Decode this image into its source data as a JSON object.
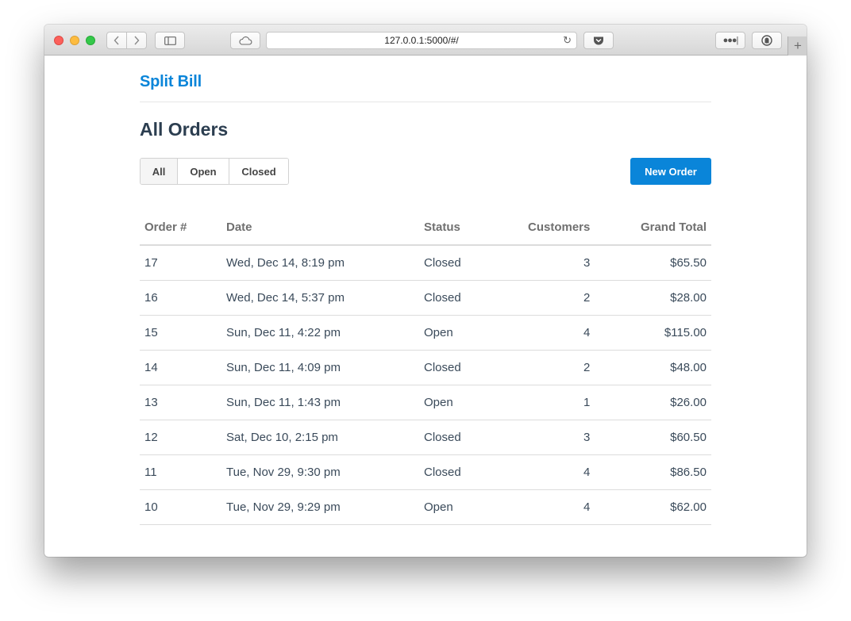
{
  "browser": {
    "url": "127.0.0.1:5000/#/"
  },
  "app": {
    "brand": "Split Bill"
  },
  "page": {
    "title": "All Orders",
    "filters": [
      "All",
      "Open",
      "Closed"
    ],
    "active_filter": "All",
    "new_order_label": "New Order"
  },
  "table": {
    "headers": [
      "Order #",
      "Date",
      "Status",
      "Customers",
      "Grand Total"
    ],
    "rows": [
      {
        "order": "17",
        "date": "Wed, Dec 14, 8:19 pm",
        "status": "Closed",
        "customers": "3",
        "total": "$65.50"
      },
      {
        "order": "16",
        "date": "Wed, Dec 14, 5:37 pm",
        "status": "Closed",
        "customers": "2",
        "total": "$28.00"
      },
      {
        "order": "15",
        "date": "Sun, Dec 11, 4:22 pm",
        "status": "Open",
        "customers": "4",
        "total": "$115.00"
      },
      {
        "order": "14",
        "date": "Sun, Dec 11, 4:09 pm",
        "status": "Closed",
        "customers": "2",
        "total": "$48.00"
      },
      {
        "order": "13",
        "date": "Sun, Dec 11, 1:43 pm",
        "status": "Open",
        "customers": "1",
        "total": "$26.00"
      },
      {
        "order": "12",
        "date": "Sat, Dec 10, 2:15 pm",
        "status": "Closed",
        "customers": "3",
        "total": "$60.50"
      },
      {
        "order": "11",
        "date": "Tue, Nov 29, 9:30 pm",
        "status": "Closed",
        "customers": "4",
        "total": "$86.50"
      },
      {
        "order": "10",
        "date": "Tue, Nov 29, 9:29 pm",
        "status": "Open",
        "customers": "4",
        "total": "$62.00"
      }
    ]
  },
  "colors": {
    "accent": "#0a85d9",
    "heading": "#2c3e50"
  }
}
